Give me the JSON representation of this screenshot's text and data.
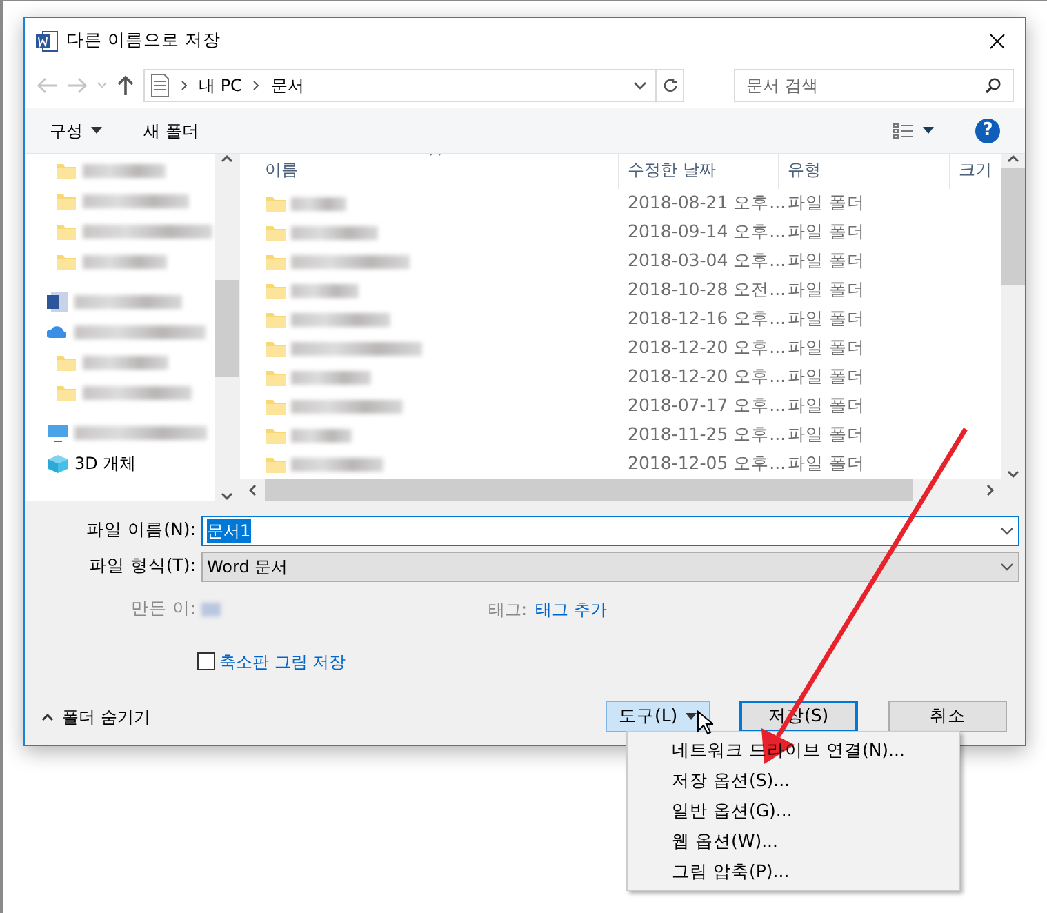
{
  "window": {
    "title": "다른 이름으로 저장"
  },
  "nav": {
    "path": [
      "내 PC",
      "문서"
    ],
    "search_placeholder": "문서 검색"
  },
  "toolbar": {
    "organize": "구성",
    "new_folder": "새 폴더",
    "help": "?"
  },
  "sidebar": {
    "items": [
      {
        "kind": "folder"
      },
      {
        "kind": "folder"
      },
      {
        "kind": "folder"
      },
      {
        "kind": "folder"
      },
      {
        "kind": "document"
      },
      {
        "kind": "cloud"
      },
      {
        "kind": "folder"
      },
      {
        "kind": "folder"
      },
      {
        "kind": "computer"
      },
      {
        "kind": "cube",
        "label": "3D 개체"
      }
    ]
  },
  "columns": [
    {
      "label": "이름",
      "sorted": true
    },
    {
      "label": "수정한 날짜",
      "sorted": false
    },
    {
      "label": "유형",
      "sorted": false
    },
    {
      "label": "크기",
      "sorted": false
    }
  ],
  "rows": [
    {
      "modified": "2018-08-21 오후...",
      "type": "파일 폴더"
    },
    {
      "modified": "2018-09-14 오후...",
      "type": "파일 폴더"
    },
    {
      "modified": "2018-03-04 오후...",
      "type": "파일 폴더"
    },
    {
      "modified": "2018-10-28 오전...",
      "type": "파일 폴더"
    },
    {
      "modified": "2018-12-16 오후...",
      "type": "파일 폴더"
    },
    {
      "modified": "2018-12-20 오후...",
      "type": "파일 폴더"
    },
    {
      "modified": "2018-12-20 오후...",
      "type": "파일 폴더"
    },
    {
      "modified": "2018-07-17 오후...",
      "type": "파일 폴더"
    },
    {
      "modified": "2018-11-25 오후...",
      "type": "파일 폴더"
    },
    {
      "modified": "2018-12-05 오후...",
      "type": "파일 폴더"
    }
  ],
  "file_name": {
    "label": "파일 이름(N):",
    "value": "문서1"
  },
  "file_type": {
    "label": "파일 형식(T):",
    "value": "Word 문서"
  },
  "author": {
    "label": "만든 이:"
  },
  "tags": {
    "label": "태그:",
    "value": "태그 추가"
  },
  "thumbnail": {
    "label": "축소판 그림 저장",
    "checked": false
  },
  "hide_folders": "폴더 숨기기",
  "buttons": {
    "tools": {
      "label": "도구(L)",
      "expanded": true
    },
    "save": "저장(S)",
    "cancel": "취소"
  },
  "menu": [
    "네트워크 드라이브 연결(N)...",
    "저장 옵션(S)...",
    "일반 옵션(G)...",
    "웹 옵션(W)...",
    "그림 압축(P)..."
  ]
}
